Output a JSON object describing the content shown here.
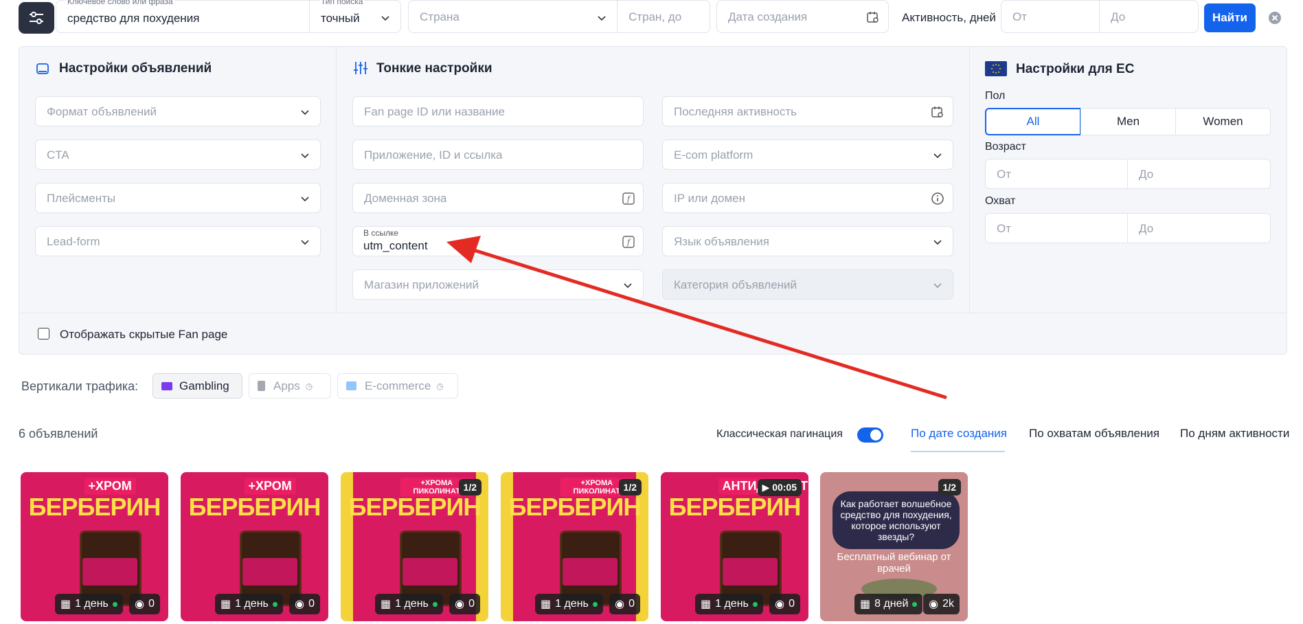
{
  "search": {
    "keyword_label": "Ключевое слово или фраза",
    "keyword_value": "средство для похудения",
    "search_type_label": "Тип поиска",
    "search_type_value": "точный",
    "country_placeholder": "Страна",
    "countries_to_placeholder": "Стран, до",
    "created_placeholder": "Дата создания",
    "activity_label": "Активность, дней",
    "activity_from": "От",
    "activity_to": "До",
    "find_button": "Найти"
  },
  "ad_settings": {
    "title": "Настройки объявлений",
    "fields": [
      "Формат объявлений",
      "CTA",
      "Плейсменты",
      "Lead-form"
    ]
  },
  "fine_settings": {
    "title": "Тонкие настройки",
    "col1": [
      "Fan page ID или название",
      "Приложение, ID и ссылка",
      "Доменная зона"
    ],
    "link_label": "В ссылке",
    "link_value": "utm_content",
    "app_store": "Магазин приложений",
    "col2": [
      "Последняя активность",
      "E-com platform",
      "IP или домен",
      "Язык объявления",
      "Категория объявлений"
    ]
  },
  "eu_settings": {
    "title": "Настройки для ЕС",
    "gender_label": "Пол",
    "genders": [
      "All",
      "Men",
      "Women"
    ],
    "age_label": "Возраст",
    "reach_label": "Охват",
    "from": "От",
    "to": "До"
  },
  "hidden_pages_label": "Отображать скрытые Fan page",
  "verticals": {
    "label": "Вертикали трафика:",
    "items": [
      "Gambling",
      "Apps",
      "E-commerce"
    ]
  },
  "results": {
    "count": "6 объявлений",
    "classic_pagination": "Классическая пагинация",
    "sort_tabs": [
      "По дате создания",
      "По охватам объявления",
      "По дням активности"
    ]
  },
  "cards": [
    {
      "badge": "",
      "days": "1 день",
      "views": "0",
      "headline": "БЕРБЕРИН",
      "sub": "+ХРОМ",
      "bg": "#ffffff"
    },
    {
      "badge": "",
      "days": "1 день",
      "views": "0",
      "headline": "БЕРБЕРИН",
      "sub": "+ХРОМ",
      "bg": "#ffffff"
    },
    {
      "badge": "1/2",
      "days": "1 день",
      "views": "0",
      "headline": "БЕРБЕРИН",
      "sub": "+ХРОМА ПИКОЛИНАТ",
      "bg": "#f3d23a"
    },
    {
      "badge": "1/2",
      "days": "1 день",
      "views": "0",
      "headline": "БЕРБЕРИН",
      "sub": "+ХРОМА ПИКОЛИНАТ",
      "bg": "#f3d23a"
    },
    {
      "badge": "00:05",
      "days": "1 день",
      "views": "0",
      "headline": "БЕРБЕРИН",
      "sub": "АНТИДИАБЕТ",
      "bg": "#c2185b"
    },
    {
      "badge": "1/2",
      "days": "8 дней",
      "views": "2k",
      "headline": "Как работает волшебное средство для похудения, которое используют звезды?",
      "sub": "Бесплатный вебинар от врачей",
      "bg": "#c98b8b"
    }
  ],
  "colors": {
    "accent": "#1463ec",
    "arrow": "#e32b24"
  }
}
